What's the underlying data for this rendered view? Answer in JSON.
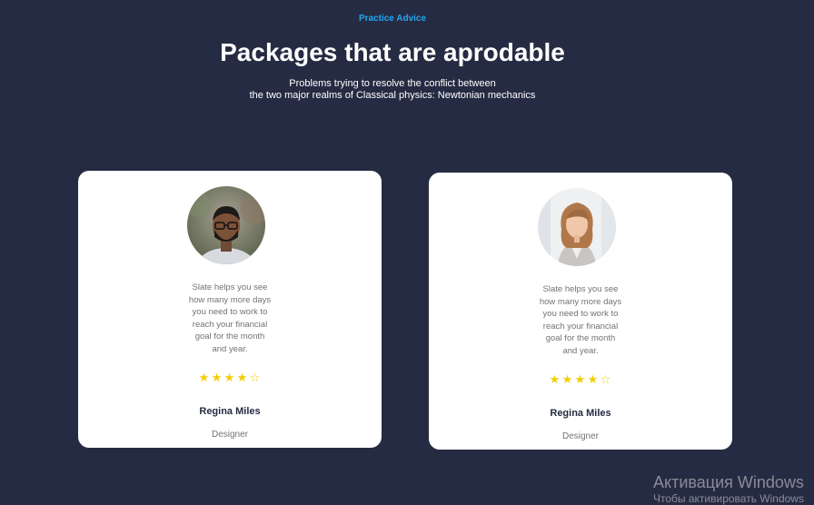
{
  "header": {
    "eyebrow": "Practice Advice",
    "title": "Packages that are aprodable",
    "subtitle_line1": "Problems trying to resolve the conflict between",
    "subtitle_line2": "the two major realms of Classical physics: Newtonian mechanics"
  },
  "cards": [
    {
      "quote_lines": [
        "Slate helps you see",
        "how many more days",
        "you need to work to",
        "reach your financial",
        "goal for the month",
        "and year."
      ],
      "rating": 4,
      "rating_max": 5,
      "name": "Regina Miles",
      "role": "Designer"
    },
    {
      "quote_lines": [
        "Slate helps you see",
        "how many more days",
        "you need to work to",
        "reach your financial",
        "goal for the month",
        "and year."
      ],
      "rating": 4,
      "rating_max": 5,
      "name": "Regina Miles",
      "role": "Designer"
    }
  ],
  "stars": {
    "filled": "★",
    "empty": "☆"
  },
  "watermark": {
    "line1": "Активация Windows",
    "line2": "Чтобы активировать Windows"
  },
  "colors": {
    "background": "#252b42",
    "accent": "#23a6f0",
    "star": "#f3cd03",
    "card": "#ffffff"
  }
}
